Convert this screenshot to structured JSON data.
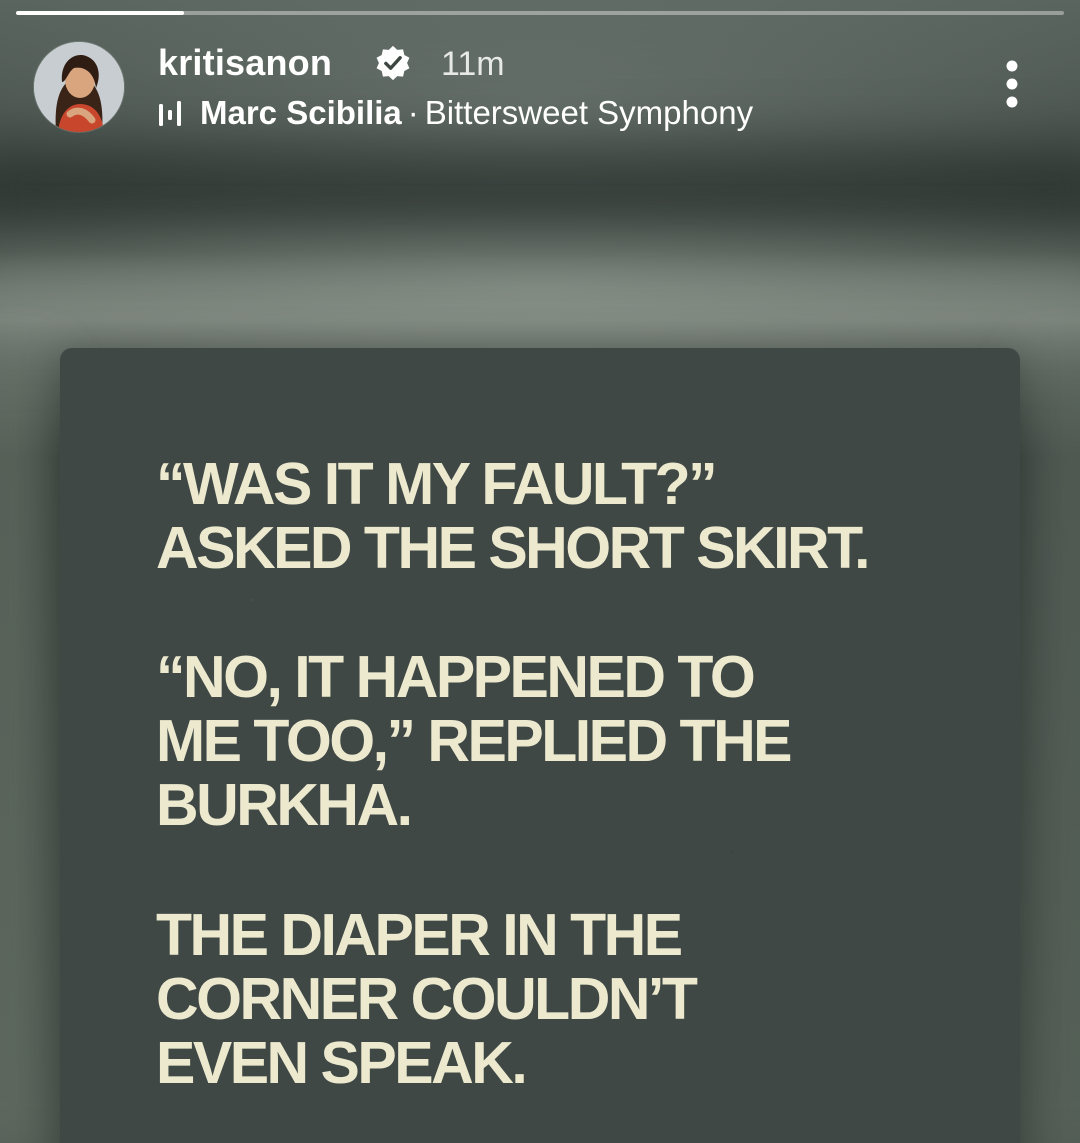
{
  "story": {
    "progress": 0.16,
    "user": {
      "username": "kritisanon",
      "verified": true,
      "time_ago": "11m"
    },
    "music": {
      "icon": "music-bars-icon",
      "artist": "Marc Scibilia",
      "separator": "·",
      "track": "Bittersweet Symphony"
    },
    "more_icon": "more-vertical-icon",
    "quote": {
      "para1": [
        "“WAS IT MY FAULT?”",
        "ASKED THE SHORT SKIRT."
      ],
      "para2": [
        "“NO, IT HAPPENED TO",
        "ME TOO,” REPLIED THE",
        "BURKHA."
      ],
      "para3": [
        "THE DIAPER IN THE",
        "CORNER COULDN’T",
        "EVEN SPEAK."
      ]
    }
  },
  "colors": {
    "card_bg": "#3f4845",
    "quote_text": "#ece9cf",
    "verified_badge": "#ffffff"
  }
}
